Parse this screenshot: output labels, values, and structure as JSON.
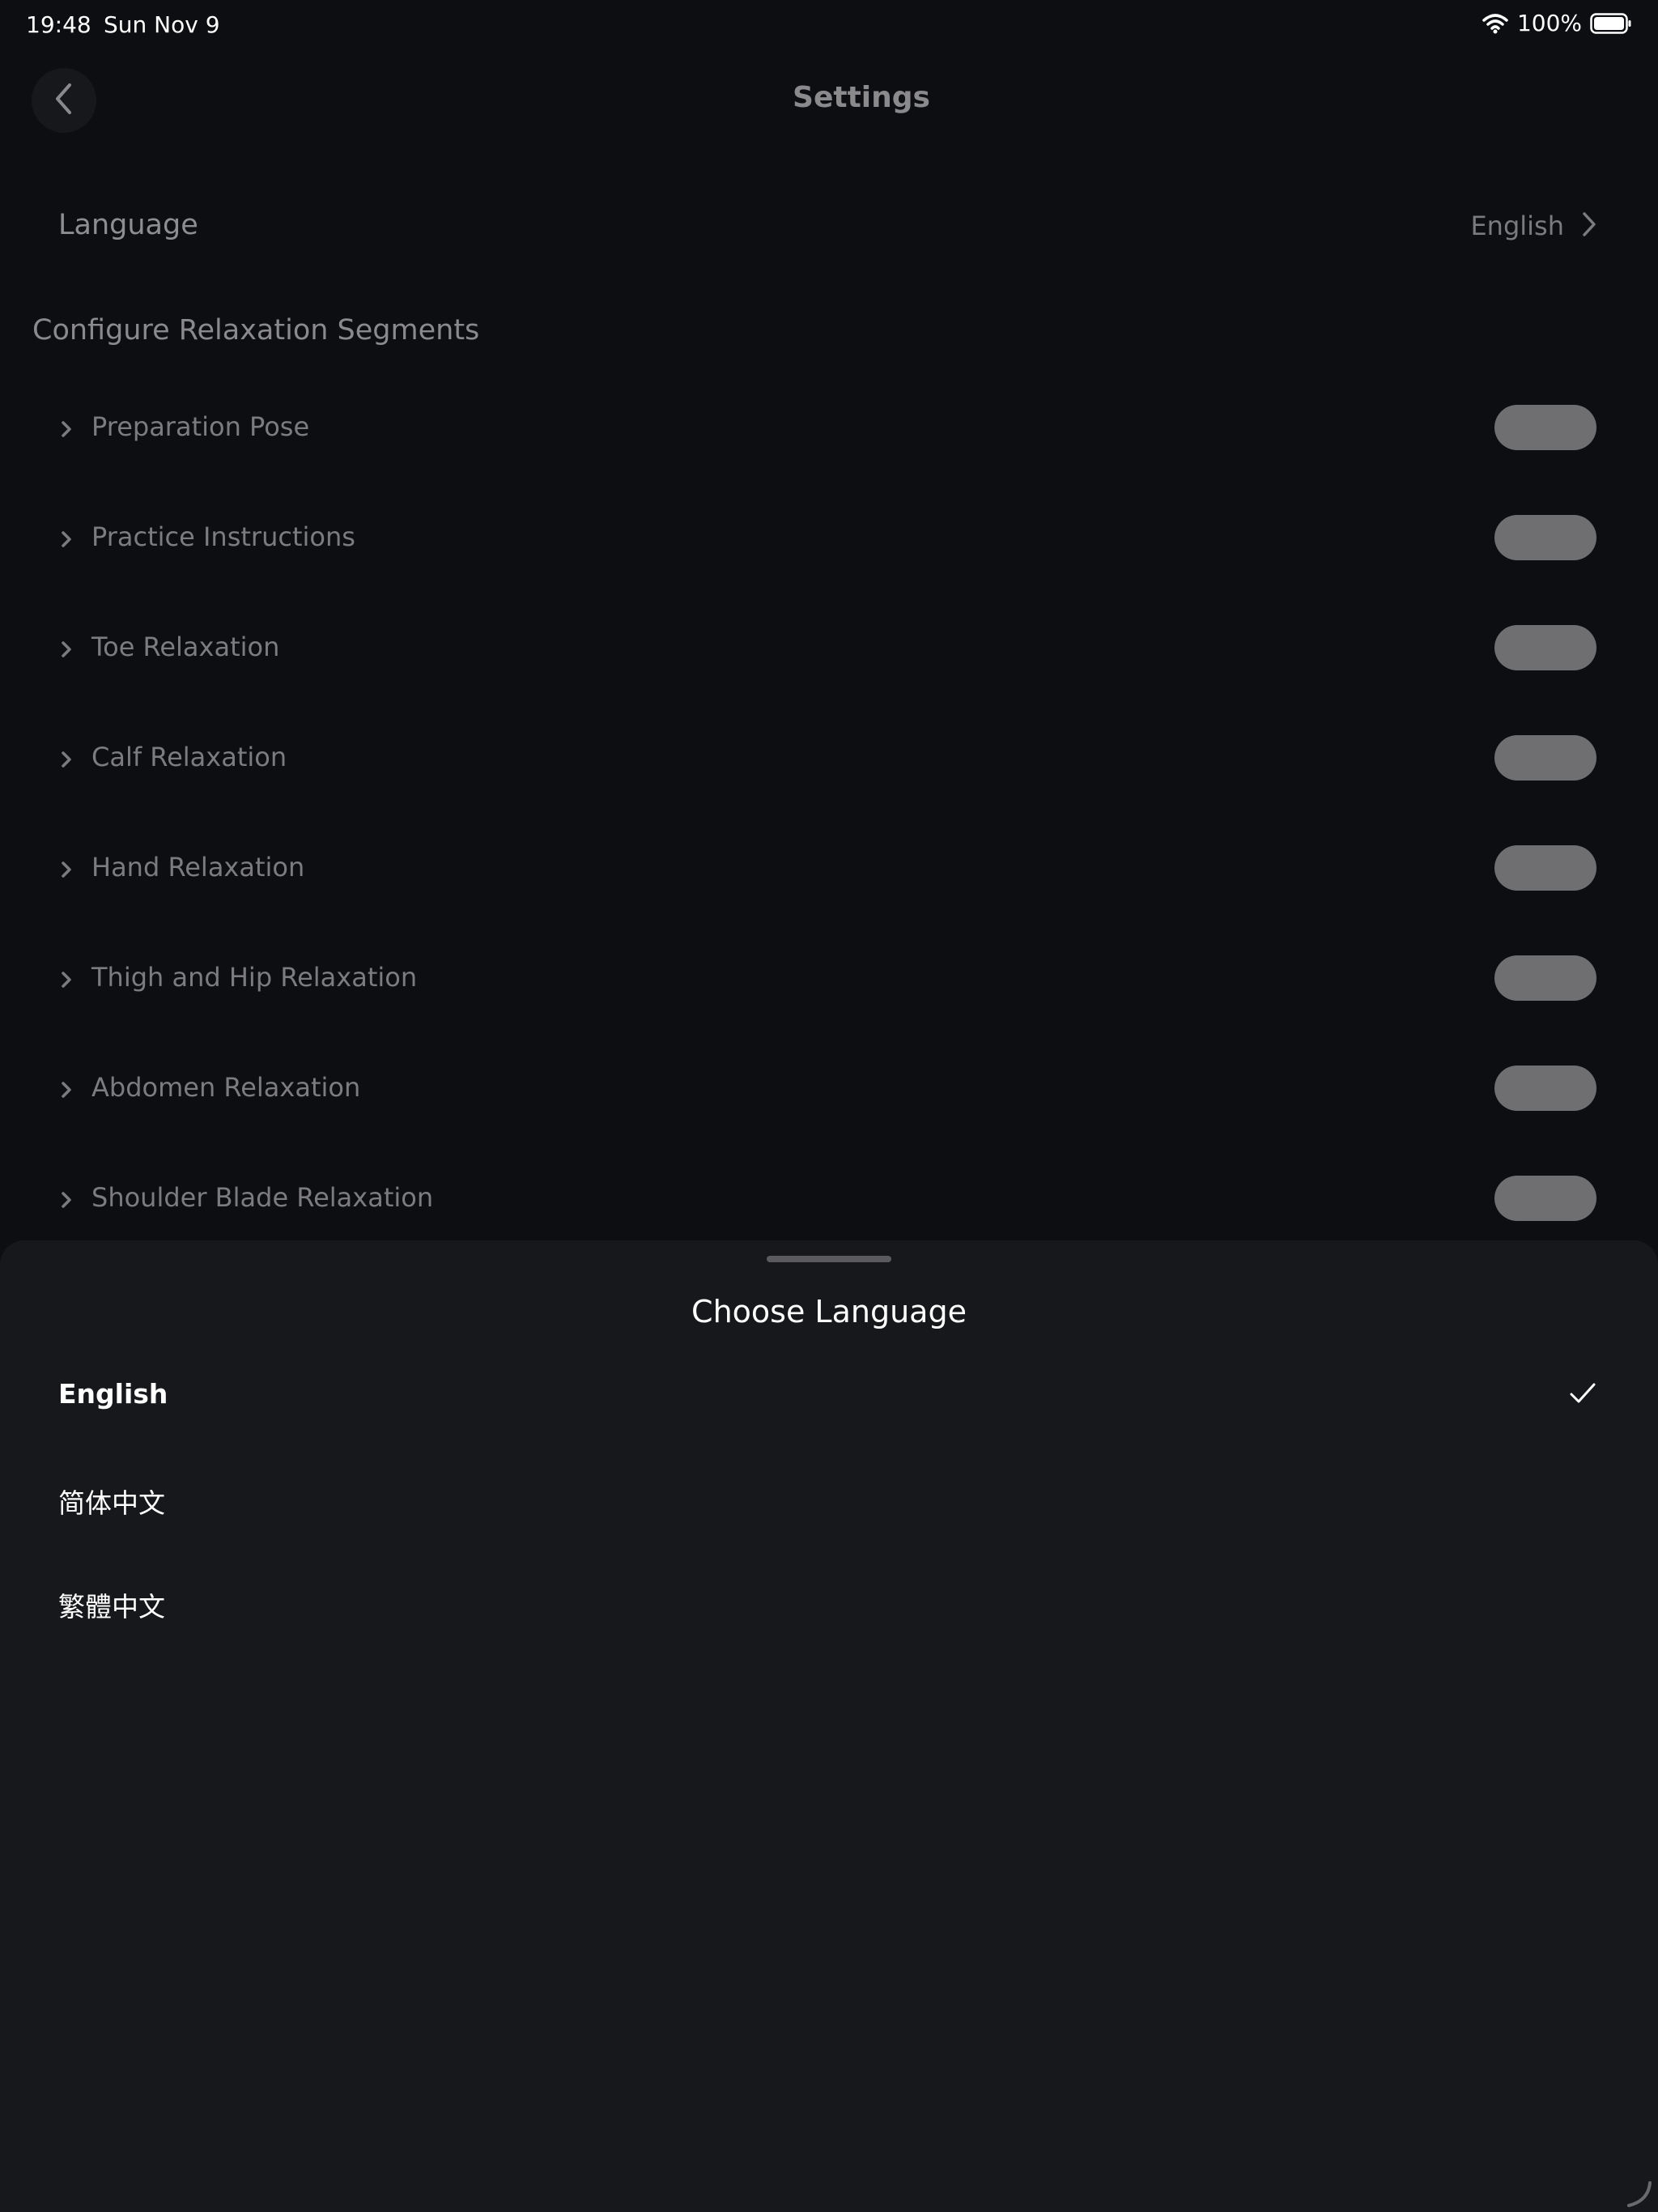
{
  "status_bar": {
    "time": "19:48",
    "date": "Sun Nov 9",
    "battery": "100%",
    "icons": [
      "wifi-icon",
      "battery-icon"
    ]
  },
  "header": {
    "title": "Settings",
    "back_icon": "chevron-left-icon"
  },
  "language_row": {
    "label": "Language",
    "value": "English"
  },
  "section": {
    "title": "Configure Relaxation Segments"
  },
  "segments": [
    {
      "label": "Preparation Pose"
    },
    {
      "label": "Practice Instructions"
    },
    {
      "label": "Toe Relaxation"
    },
    {
      "label": "Calf Relaxation"
    },
    {
      "label": "Hand Relaxation"
    },
    {
      "label": "Thigh and Hip Relaxation"
    },
    {
      "label": "Abdomen Relaxation"
    },
    {
      "label": "Shoulder Blade Relaxation"
    }
  ],
  "sheet": {
    "title": "Choose Language",
    "options": [
      {
        "label": "English",
        "selected": true
      },
      {
        "label": "简体中文",
        "selected": false
      },
      {
        "label": "繁體中文",
        "selected": false
      }
    ]
  },
  "colors": {
    "background": "#0d0e11",
    "sheet": "#17181b",
    "toggle": "#6f6f72",
    "text_primary": "#ffffff",
    "text_dimmed": "#8a8a8d"
  }
}
